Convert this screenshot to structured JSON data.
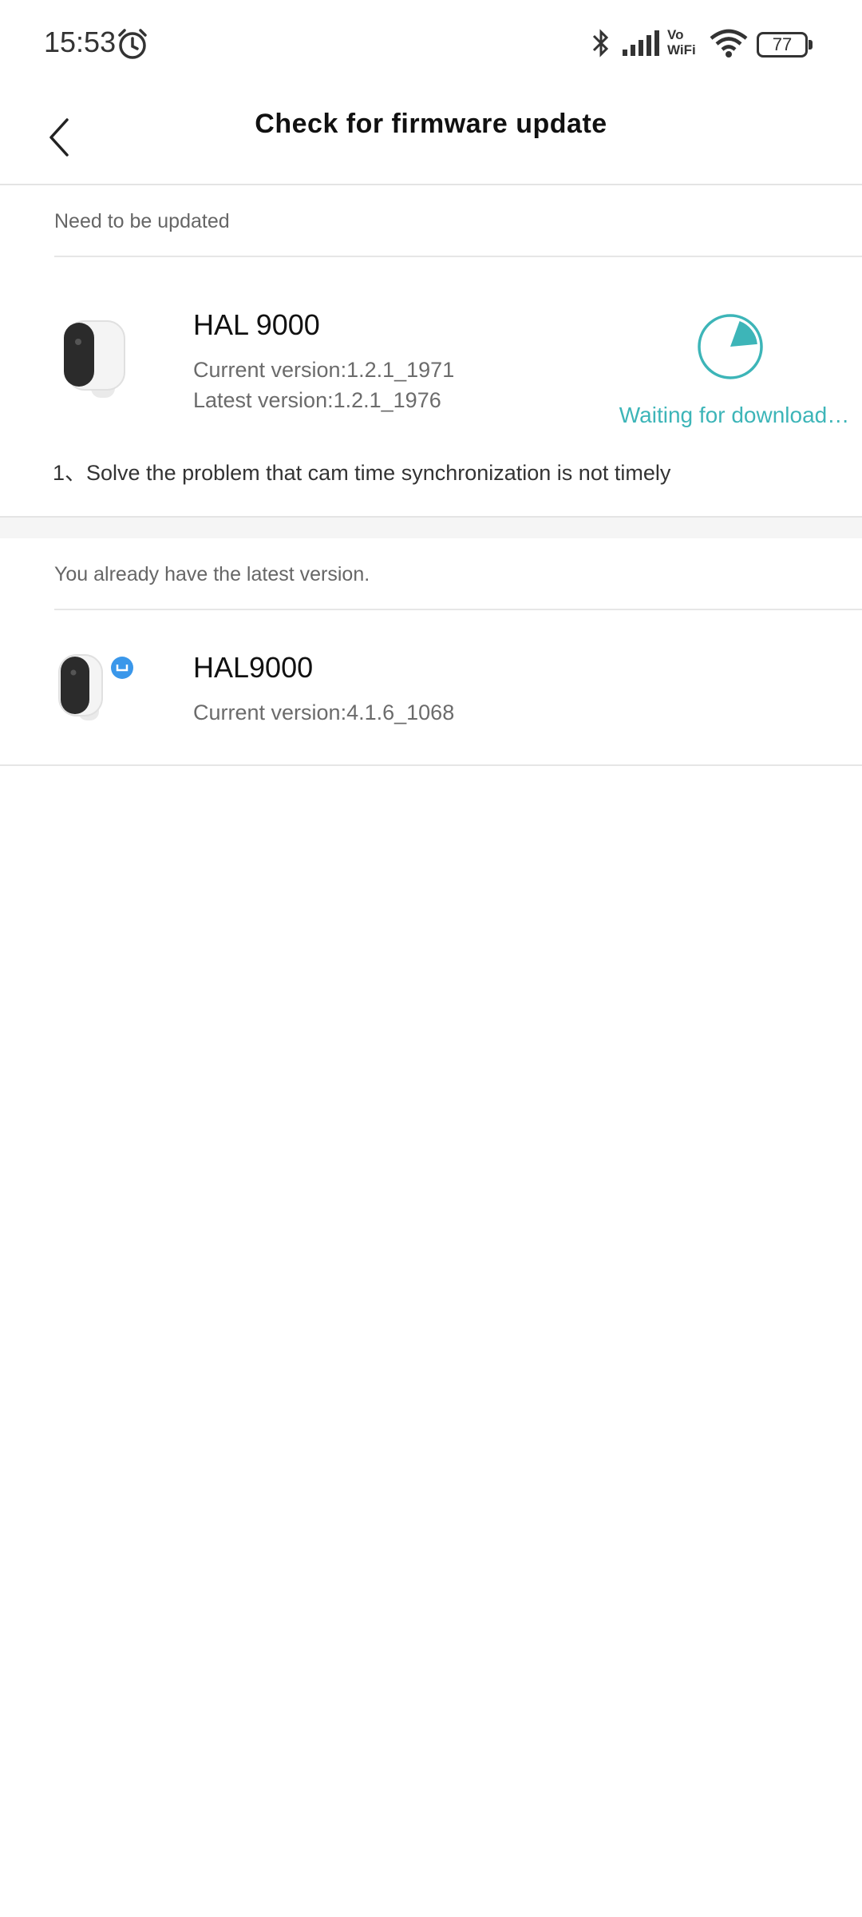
{
  "status_bar": {
    "time": "15:53",
    "battery": "77",
    "vowifi_top": "Vo",
    "vowifi_bottom": "WiFi",
    "icons": [
      "alarm-icon",
      "bluetooth-icon",
      "signal-icon",
      "wifi-icon",
      "battery-icon"
    ]
  },
  "header": {
    "title": "Check for firmware update",
    "back_icon": "chevron-left-icon"
  },
  "sections": {
    "needs_update": {
      "label": "Need to be updated",
      "device": {
        "name": "HAL 9000",
        "current_version": "Current version:1.2.1_1971",
        "latest_version": "Latest version:1.2.1_1976",
        "status": "Waiting for download…",
        "progress": 0.18,
        "release_note": "1、Solve the problem that cam time synchronization is not timely"
      }
    },
    "up_to_date": {
      "label": "You already have the latest version.",
      "device": {
        "name": "HAL9000",
        "current_version": "Current version:4.1.6_1068"
      }
    }
  },
  "colors": {
    "accent": "#3db5b8",
    "badge": "#3a97ea",
    "divider": "#e6e6e6"
  }
}
